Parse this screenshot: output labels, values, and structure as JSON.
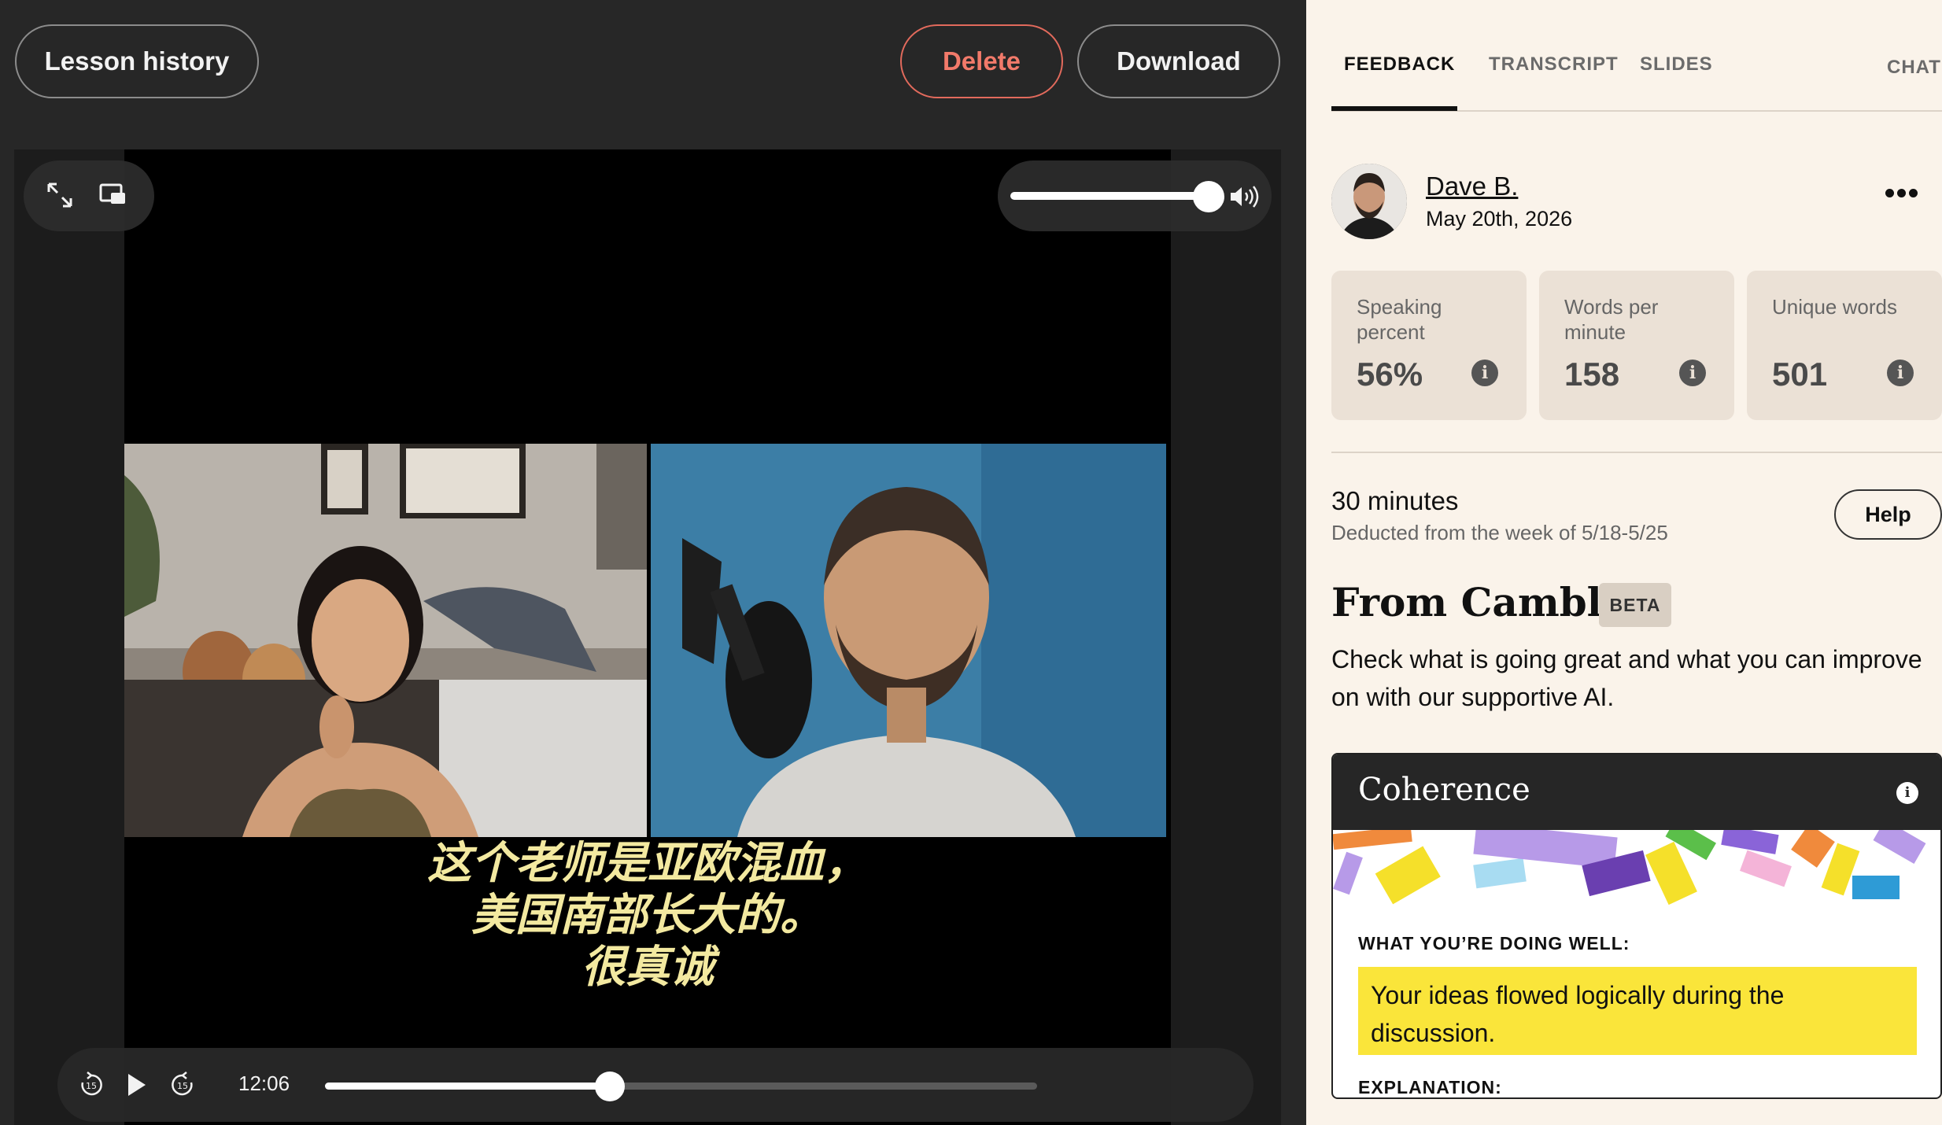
{
  "header": {
    "lesson_history": "Lesson history",
    "delete": "Delete",
    "download": "Download"
  },
  "video": {
    "subtitles": [
      "这个老师是亚欧混血，",
      "美国南部长大的。",
      "很真诚"
    ],
    "current_time": "12:06",
    "progress_fraction": 0.4,
    "volume_fraction": 0.9
  },
  "tabs": [
    {
      "label": "FEEDBACK",
      "active": true
    },
    {
      "label": "TRANSCRIPT",
      "active": false
    },
    {
      "label": "SLIDES",
      "active": false
    },
    {
      "label": "CHAT",
      "active": false
    }
  ],
  "tutor": {
    "name": "Dave B.",
    "date": "May 20th, 2026"
  },
  "stats": [
    {
      "label": "Speaking percent",
      "value": "56%"
    },
    {
      "label": "Words per minute",
      "value": "158"
    },
    {
      "label": "Unique words",
      "value": "501"
    }
  ],
  "lesson": {
    "duration": "30 minutes",
    "deducted": "Deducted from the week of 5/18-5/25",
    "help": "Help"
  },
  "cambly": {
    "title": "From Cambly",
    "badge": "BETA",
    "description": "Check what is going great and what you can improve on with our supportive AI."
  },
  "coherence": {
    "title": "Coherence",
    "well_heading": "WHAT YOU’RE DOING WELL:",
    "well_text": "Your ideas flowed logically during the discussion.",
    "explanation_heading": "EXPLANATION:"
  },
  "colors": {
    "delete_accent": "#f27a6a",
    "highlight": "#fae53a",
    "panel_bg": "#faf3ea"
  }
}
